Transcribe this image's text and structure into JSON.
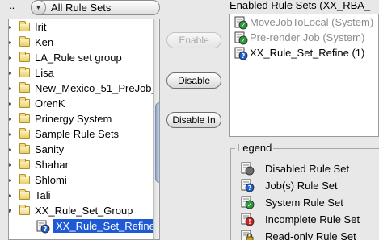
{
  "header": {
    "path_dots": "..",
    "ruleset_filter": "All Rule Sets",
    "enabled_title": "Enabled Rule Sets (XX_RBA_"
  },
  "tree": {
    "folders": [
      {
        "label": "Irit",
        "open": false
      },
      {
        "label": "Ken",
        "open": false
      },
      {
        "label": "LA_Rule set group",
        "open": false
      },
      {
        "label": "Lisa",
        "open": false
      },
      {
        "label": "New_Mexico_51_PreJob_",
        "open": false
      },
      {
        "label": "OrenK",
        "open": false
      },
      {
        "label": "Prinergy System",
        "open": false
      },
      {
        "label": "Sample Rule Sets",
        "open": false
      },
      {
        "label": "Sanity",
        "open": false
      },
      {
        "label": "Shahar",
        "open": false
      },
      {
        "label": "Shlomi",
        "open": false
      },
      {
        "label": "Tali",
        "open": false
      },
      {
        "label": "XX_Rule_Set_Group",
        "open": true
      }
    ],
    "selected_child": {
      "label": "XX_Rule_Set_Refine",
      "icon": "job-rule-set-icon"
    }
  },
  "buttons": {
    "enable": "Enable",
    "disable": "Disable",
    "disable_in": "Disable In"
  },
  "enabled_list": [
    {
      "label": "MoveJobToLocal (System)",
      "icon": "system-rule-set-icon",
      "kind": "system"
    },
    {
      "label": "Pre-render Job (System)",
      "icon": "system-rule-set-icon",
      "kind": "system"
    },
    {
      "label": "XX_Rule_Set_Refine (1)",
      "icon": "job-rule-set-icon",
      "kind": "job"
    }
  ],
  "legend": {
    "title": "Legend",
    "items": [
      {
        "label": "Disabled Rule Set",
        "icon": "disabled-rule-set-icon"
      },
      {
        "label": "Job(s) Rule Set",
        "icon": "job-rule-set-icon"
      },
      {
        "label": "System Rule Set",
        "icon": "system-rule-set-icon"
      },
      {
        "label": "Incomplete Rule Set",
        "icon": "incomplete-rule-set-icon"
      },
      {
        "label": "Read-only Rule Set",
        "icon": "read-only-rule-set-icon"
      }
    ]
  },
  "colors": {
    "selection": "#1f5ad6",
    "job_badge": "#1b5fd1",
    "system_badge": "#2a9a3a",
    "incomplete_badge": "#d22020",
    "folder": "#e8cf66"
  }
}
